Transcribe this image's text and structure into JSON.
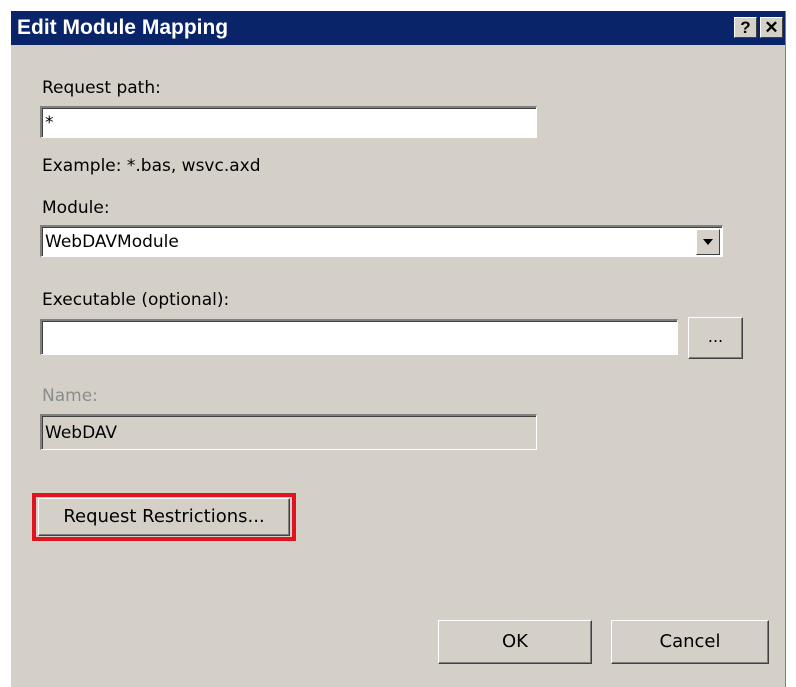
{
  "window": {
    "title": "Edit Module Mapping",
    "help_label": "?",
    "close_label": "✕"
  },
  "request_path": {
    "label": "Request path:",
    "value": "*",
    "example": "Example: *.bas, wsvc.axd"
  },
  "module": {
    "label": "Module:",
    "selected": "WebDAVModule"
  },
  "executable": {
    "label": "Executable (optional):",
    "value": "",
    "browse_label": "..."
  },
  "name": {
    "label": "Name:",
    "value": "WebDAV"
  },
  "buttons": {
    "request_restrictions": "Request Restrictions...",
    "ok": "OK",
    "cancel": "Cancel"
  },
  "colors": {
    "titlebar": "#0a246a",
    "dialog_bg": "#d4d0c8",
    "highlight": "#e0141e"
  }
}
